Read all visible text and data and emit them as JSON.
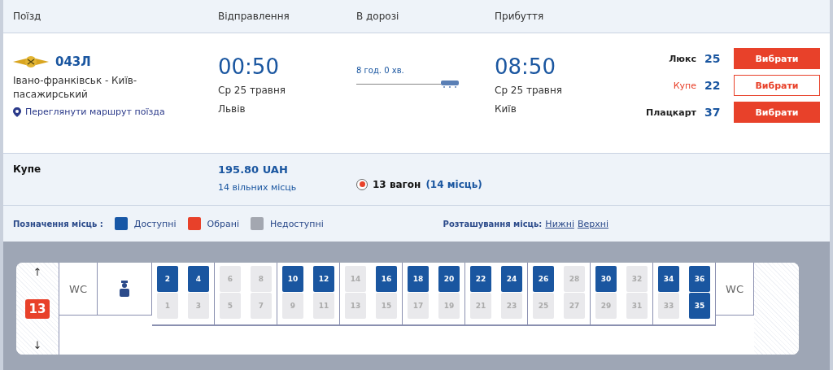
{
  "header": {
    "columns": [
      "Поїзд",
      "Відправлення",
      "В дорозі",
      "Прибуття"
    ]
  },
  "train": {
    "number": "043Л",
    "route": "Івано-франківськ - Київ-пасажирський",
    "route_link": "Переглянути маршрут поїзда",
    "departure": {
      "time": "00:50",
      "date": "Ср 25 травня",
      "station": "Львів"
    },
    "duration": "8 год. 0 хв.",
    "arrival": {
      "time": "08:50",
      "date": "Ср 25 травня",
      "station": "Київ"
    },
    "classes": [
      {
        "name": "Люкс",
        "count": "25",
        "button": "Вибрати",
        "selected": false
      },
      {
        "name": "Купе",
        "count": "22",
        "button": "Вибрати",
        "selected": true
      },
      {
        "name": "Плацкарт",
        "count": "37",
        "button": "Вибрати",
        "selected": false
      }
    ]
  },
  "coach_class": {
    "name": "Купе",
    "price": "195.80 UAH",
    "free": "14 вільних місць",
    "wagon": {
      "label": "13 вагон",
      "places": "(14 місць)",
      "selected": true
    }
  },
  "legend": {
    "title": "Позначення місць :",
    "items": [
      {
        "label": "Доступні",
        "color": "#1757a6"
      },
      {
        "label": "Обрані",
        "color": "#e8412a"
      },
      {
        "label": "Недоступні",
        "color": "#a3a7b0"
      }
    ],
    "position_title": "Розташування місць:",
    "position_links": [
      "Нижні",
      "Верхні"
    ]
  },
  "car": {
    "up_arrow": "↑",
    "down_arrow": "↓",
    "number": "13",
    "wc_left": "WC",
    "wc_right": "WC",
    "compartments": [
      {
        "seats": [
          {
            "number": "2",
            "available": true
          },
          {
            "number": "1",
            "available": false
          },
          {
            "number": "4",
            "available": true
          },
          {
            "number": "3",
            "available": false
          }
        ]
      },
      {
        "seats": [
          {
            "number": "6",
            "available": false
          },
          {
            "number": "5",
            "available": false
          },
          {
            "number": "8",
            "available": false
          },
          {
            "number": "7",
            "available": false
          }
        ]
      },
      {
        "seats": [
          {
            "number": "10",
            "available": true
          },
          {
            "number": "9",
            "available": false
          },
          {
            "number": "12",
            "available": true
          },
          {
            "number": "11",
            "available": false
          }
        ]
      },
      {
        "seats": [
          {
            "number": "14",
            "available": false
          },
          {
            "number": "13",
            "available": false
          },
          {
            "number": "16",
            "available": true
          },
          {
            "number": "15",
            "available": false
          }
        ]
      },
      {
        "seats": [
          {
            "number": "18",
            "available": true
          },
          {
            "number": "17",
            "available": false
          },
          {
            "number": "20",
            "available": true
          },
          {
            "number": "19",
            "available": false
          }
        ]
      },
      {
        "seats": [
          {
            "number": "22",
            "available": true
          },
          {
            "number": "21",
            "available": false
          },
          {
            "number": "24",
            "available": true
          },
          {
            "number": "23",
            "available": false
          }
        ]
      },
      {
        "seats": [
          {
            "number": "26",
            "available": true
          },
          {
            "number": "25",
            "available": false
          },
          {
            "number": "28",
            "available": false
          },
          {
            "number": "27",
            "available": false
          }
        ]
      },
      {
        "seats": [
          {
            "number": "30",
            "available": true
          },
          {
            "number": "29",
            "available": false
          },
          {
            "number": "32",
            "available": false
          },
          {
            "number": "31",
            "available": false
          }
        ]
      },
      {
        "seats": [
          {
            "number": "34",
            "available": true
          },
          {
            "number": "33",
            "available": false
          },
          {
            "number": "36",
            "available": true
          },
          {
            "number": "35",
            "available": true
          }
        ]
      }
    ]
  }
}
